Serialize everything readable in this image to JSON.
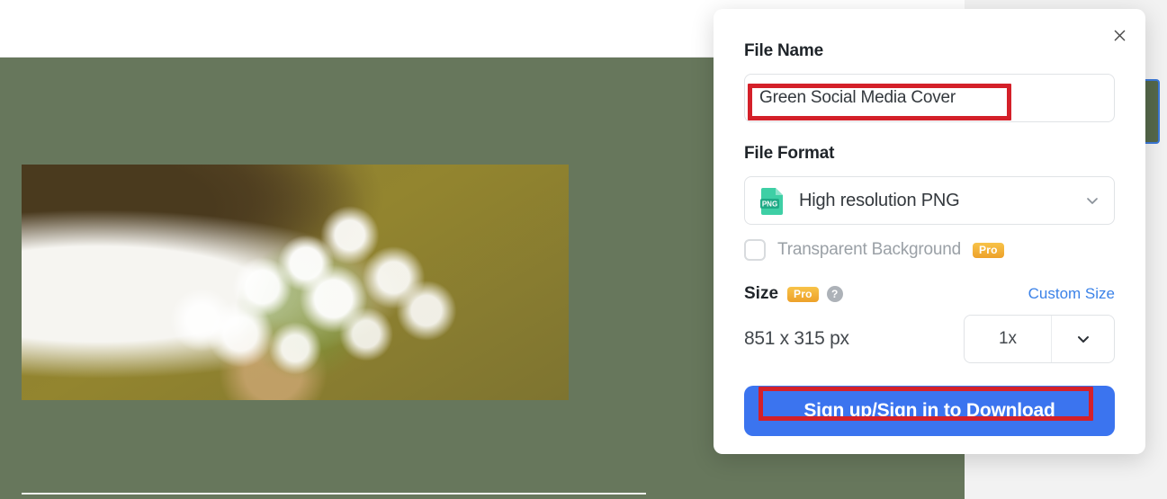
{
  "dialog": {
    "close_icon": "close-icon",
    "file_name": {
      "label": "File Name",
      "value": "Green Social Media Cover",
      "placeholder": "File Name"
    },
    "file_format": {
      "label": "File Format",
      "selected": "High resolution PNG",
      "icon_label": "PNG",
      "chevron_icon": "chevron-down-icon",
      "transparent_background": {
        "label": "Transparent Background",
        "checked": false,
        "badge": "Pro"
      }
    },
    "size": {
      "label": "Size",
      "badge": "Pro",
      "help_icon": "?",
      "custom_size_link": "Custom Size",
      "dimensions": "851 x 315 px",
      "scale": "1x",
      "scale_chevron_icon": "chevron-down-icon"
    },
    "download_button": "Sign up/Sign in to Download"
  },
  "colors": {
    "accent_blue": "#3b74ef",
    "link_blue": "#3b82e8",
    "annotation_red": "#d42029",
    "pro_gold": "#eda12a",
    "canvas_green": "#67775c",
    "png_teal": "#2fc3a0"
  }
}
